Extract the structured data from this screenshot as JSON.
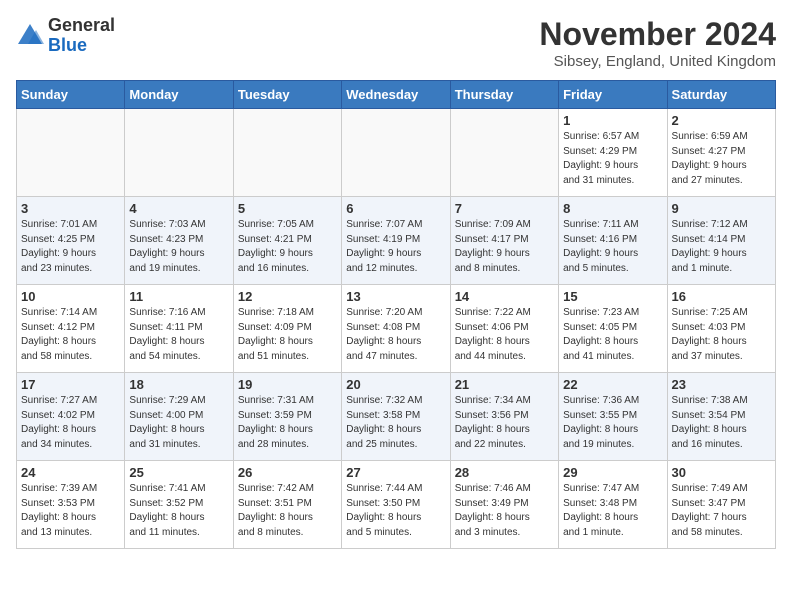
{
  "header": {
    "logo_general": "General",
    "logo_blue": "Blue",
    "month_title": "November 2024",
    "location": "Sibsey, England, United Kingdom"
  },
  "days_of_week": [
    "Sunday",
    "Monday",
    "Tuesday",
    "Wednesday",
    "Thursday",
    "Friday",
    "Saturday"
  ],
  "weeks": [
    [
      {
        "day": "",
        "info": "",
        "empty": true
      },
      {
        "day": "",
        "info": "",
        "empty": true
      },
      {
        "day": "",
        "info": "",
        "empty": true
      },
      {
        "day": "",
        "info": "",
        "empty": true
      },
      {
        "day": "",
        "info": "",
        "empty": true
      },
      {
        "day": "1",
        "info": "Sunrise: 6:57 AM\nSunset: 4:29 PM\nDaylight: 9 hours\nand 31 minutes."
      },
      {
        "day": "2",
        "info": "Sunrise: 6:59 AM\nSunset: 4:27 PM\nDaylight: 9 hours\nand 27 minutes."
      }
    ],
    [
      {
        "day": "3",
        "info": "Sunrise: 7:01 AM\nSunset: 4:25 PM\nDaylight: 9 hours\nand 23 minutes."
      },
      {
        "day": "4",
        "info": "Sunrise: 7:03 AM\nSunset: 4:23 PM\nDaylight: 9 hours\nand 19 minutes."
      },
      {
        "day": "5",
        "info": "Sunrise: 7:05 AM\nSunset: 4:21 PM\nDaylight: 9 hours\nand 16 minutes."
      },
      {
        "day": "6",
        "info": "Sunrise: 7:07 AM\nSunset: 4:19 PM\nDaylight: 9 hours\nand 12 minutes."
      },
      {
        "day": "7",
        "info": "Sunrise: 7:09 AM\nSunset: 4:17 PM\nDaylight: 9 hours\nand 8 minutes."
      },
      {
        "day": "8",
        "info": "Sunrise: 7:11 AM\nSunset: 4:16 PM\nDaylight: 9 hours\nand 5 minutes."
      },
      {
        "day": "9",
        "info": "Sunrise: 7:12 AM\nSunset: 4:14 PM\nDaylight: 9 hours\nand 1 minute."
      }
    ],
    [
      {
        "day": "10",
        "info": "Sunrise: 7:14 AM\nSunset: 4:12 PM\nDaylight: 8 hours\nand 58 minutes."
      },
      {
        "day": "11",
        "info": "Sunrise: 7:16 AM\nSunset: 4:11 PM\nDaylight: 8 hours\nand 54 minutes."
      },
      {
        "day": "12",
        "info": "Sunrise: 7:18 AM\nSunset: 4:09 PM\nDaylight: 8 hours\nand 51 minutes."
      },
      {
        "day": "13",
        "info": "Sunrise: 7:20 AM\nSunset: 4:08 PM\nDaylight: 8 hours\nand 47 minutes."
      },
      {
        "day": "14",
        "info": "Sunrise: 7:22 AM\nSunset: 4:06 PM\nDaylight: 8 hours\nand 44 minutes."
      },
      {
        "day": "15",
        "info": "Sunrise: 7:23 AM\nSunset: 4:05 PM\nDaylight: 8 hours\nand 41 minutes."
      },
      {
        "day": "16",
        "info": "Sunrise: 7:25 AM\nSunset: 4:03 PM\nDaylight: 8 hours\nand 37 minutes."
      }
    ],
    [
      {
        "day": "17",
        "info": "Sunrise: 7:27 AM\nSunset: 4:02 PM\nDaylight: 8 hours\nand 34 minutes."
      },
      {
        "day": "18",
        "info": "Sunrise: 7:29 AM\nSunset: 4:00 PM\nDaylight: 8 hours\nand 31 minutes."
      },
      {
        "day": "19",
        "info": "Sunrise: 7:31 AM\nSunset: 3:59 PM\nDaylight: 8 hours\nand 28 minutes."
      },
      {
        "day": "20",
        "info": "Sunrise: 7:32 AM\nSunset: 3:58 PM\nDaylight: 8 hours\nand 25 minutes."
      },
      {
        "day": "21",
        "info": "Sunrise: 7:34 AM\nSunset: 3:56 PM\nDaylight: 8 hours\nand 22 minutes."
      },
      {
        "day": "22",
        "info": "Sunrise: 7:36 AM\nSunset: 3:55 PM\nDaylight: 8 hours\nand 19 minutes."
      },
      {
        "day": "23",
        "info": "Sunrise: 7:38 AM\nSunset: 3:54 PM\nDaylight: 8 hours\nand 16 minutes."
      }
    ],
    [
      {
        "day": "24",
        "info": "Sunrise: 7:39 AM\nSunset: 3:53 PM\nDaylight: 8 hours\nand 13 minutes."
      },
      {
        "day": "25",
        "info": "Sunrise: 7:41 AM\nSunset: 3:52 PM\nDaylight: 8 hours\nand 11 minutes."
      },
      {
        "day": "26",
        "info": "Sunrise: 7:42 AM\nSunset: 3:51 PM\nDaylight: 8 hours\nand 8 minutes."
      },
      {
        "day": "27",
        "info": "Sunrise: 7:44 AM\nSunset: 3:50 PM\nDaylight: 8 hours\nand 5 minutes."
      },
      {
        "day": "28",
        "info": "Sunrise: 7:46 AM\nSunset: 3:49 PM\nDaylight: 8 hours\nand 3 minutes."
      },
      {
        "day": "29",
        "info": "Sunrise: 7:47 AM\nSunset: 3:48 PM\nDaylight: 8 hours\nand 1 minute."
      },
      {
        "day": "30",
        "info": "Sunrise: 7:49 AM\nSunset: 3:47 PM\nDaylight: 7 hours\nand 58 minutes."
      }
    ]
  ]
}
